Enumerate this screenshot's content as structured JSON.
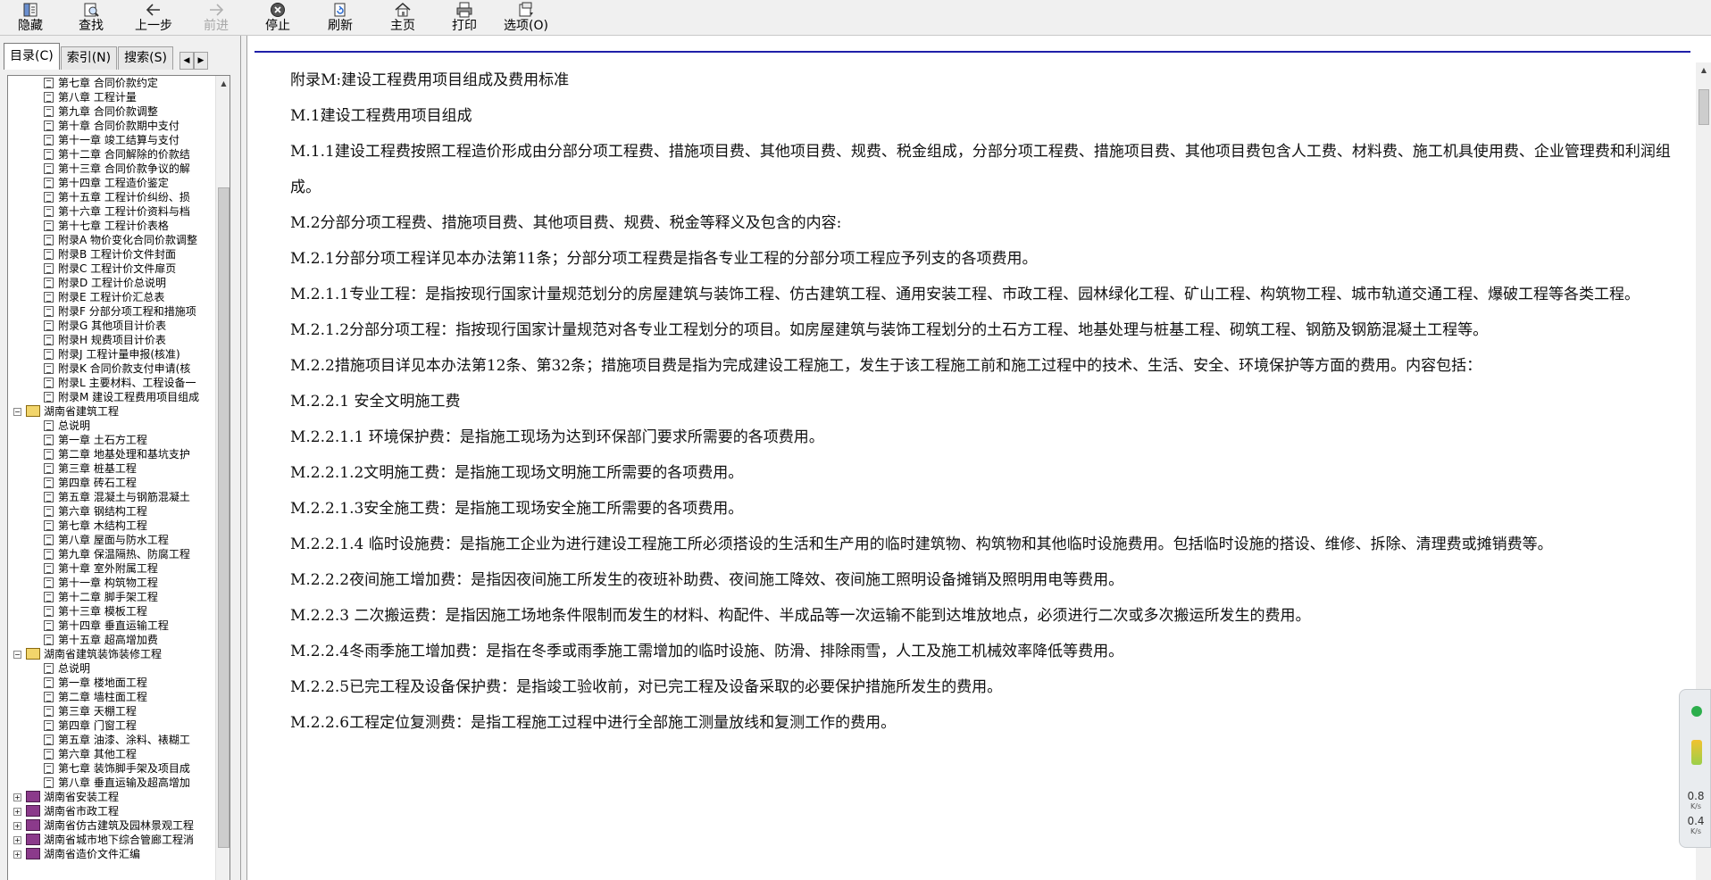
{
  "toolbar": {
    "hide": "隐藏",
    "find": "查找",
    "back": "上一步",
    "forward": "前进",
    "stop": "停止",
    "refresh": "刷新",
    "home": "主页",
    "print": "打印",
    "options": "选项(O)"
  },
  "tabs": {
    "contents": "目录(C)",
    "index": "索引(N)",
    "search": "搜索(S)"
  },
  "tree": {
    "items": [
      {
        "level": 2,
        "kind": "doc",
        "label": "第七章 合同价款约定"
      },
      {
        "level": 2,
        "kind": "doc",
        "label": "第八章 工程计量"
      },
      {
        "level": 2,
        "kind": "doc",
        "label": "第九章 合同价款调整"
      },
      {
        "level": 2,
        "kind": "doc",
        "label": "第十章 合同价款期中支付"
      },
      {
        "level": 2,
        "kind": "doc",
        "label": "第十一章 竣工结算与支付"
      },
      {
        "level": 2,
        "kind": "doc",
        "label": "第十二章 合同解除的价款结"
      },
      {
        "level": 2,
        "kind": "doc",
        "label": "第十三章 合同价款争议的解"
      },
      {
        "level": 2,
        "kind": "doc",
        "label": "第十四章 工程造价鉴定"
      },
      {
        "level": 2,
        "kind": "doc",
        "label": "第十五章 工程计价纠纷、损"
      },
      {
        "level": 2,
        "kind": "doc",
        "label": "第十六章 工程计价资料与档"
      },
      {
        "level": 2,
        "kind": "doc",
        "label": "第十七章 工程计价表格"
      },
      {
        "level": 2,
        "kind": "doc",
        "label": "附录A 物价变化合同价款调整"
      },
      {
        "level": 2,
        "kind": "doc",
        "label": "附录B 工程计价文件封面"
      },
      {
        "level": 2,
        "kind": "doc",
        "label": "附录C 工程计价文件扉页"
      },
      {
        "level": 2,
        "kind": "doc",
        "label": "附录D 工程计价总说明"
      },
      {
        "level": 2,
        "kind": "doc",
        "label": "附录E 工程计价汇总表"
      },
      {
        "level": 2,
        "kind": "doc",
        "label": "附录F 分部分项工程和措施项"
      },
      {
        "level": 2,
        "kind": "doc",
        "label": "附录G 其他项目计价表"
      },
      {
        "level": 2,
        "kind": "doc",
        "label": "附录H 规费项目计价表"
      },
      {
        "level": 2,
        "kind": "doc",
        "label": "附录J 工程计量申报(核准)"
      },
      {
        "level": 2,
        "kind": "doc",
        "label": "附录K 合同价款支付申请(核"
      },
      {
        "level": 2,
        "kind": "doc",
        "label": "附录L 主要材料、工程设备一"
      },
      {
        "level": 2,
        "kind": "doc",
        "label": "附录M 建设工程费用项目组成"
      },
      {
        "level": 1,
        "kind": "book-open",
        "toggle": "−",
        "label": "湖南省建筑工程"
      },
      {
        "level": 2,
        "kind": "doc",
        "label": "总说明"
      },
      {
        "level": 2,
        "kind": "doc",
        "label": "第一章 土石方工程"
      },
      {
        "level": 2,
        "kind": "doc",
        "label": "第二章 地基处理和基坑支护"
      },
      {
        "level": 2,
        "kind": "doc",
        "label": "第三章 桩基工程"
      },
      {
        "level": 2,
        "kind": "doc",
        "label": "第四章 砖石工程"
      },
      {
        "level": 2,
        "kind": "doc",
        "label": "第五章 混凝土与钢筋混凝土"
      },
      {
        "level": 2,
        "kind": "doc",
        "label": "第六章 钢结构工程"
      },
      {
        "level": 2,
        "kind": "doc",
        "label": "第七章 木结构工程"
      },
      {
        "level": 2,
        "kind": "doc",
        "label": "第八章 屋面与防水工程"
      },
      {
        "level": 2,
        "kind": "doc",
        "label": "第九章 保温隔热、防腐工程"
      },
      {
        "level": 2,
        "kind": "doc",
        "label": "第十章 室外附属工程"
      },
      {
        "level": 2,
        "kind": "doc",
        "label": "第十一章 构筑物工程"
      },
      {
        "level": 2,
        "kind": "doc",
        "label": "第十二章 脚手架工程"
      },
      {
        "level": 2,
        "kind": "doc",
        "label": "第十三章 模板工程"
      },
      {
        "level": 2,
        "kind": "doc",
        "label": "第十四章 垂直运输工程"
      },
      {
        "level": 2,
        "kind": "doc",
        "label": "第十五章 超高增加费"
      },
      {
        "level": 1,
        "kind": "book-open",
        "toggle": "−",
        "label": "湖南省建筑装饰装修工程"
      },
      {
        "level": 2,
        "kind": "doc",
        "label": "总说明"
      },
      {
        "level": 2,
        "kind": "doc",
        "label": "第一章 楼地面工程"
      },
      {
        "level": 2,
        "kind": "doc",
        "label": "第二章 墙柱面工程"
      },
      {
        "level": 2,
        "kind": "doc",
        "label": "第三章 天棚工程"
      },
      {
        "level": 2,
        "kind": "doc",
        "label": "第四章 门窗工程"
      },
      {
        "level": 2,
        "kind": "doc",
        "label": "第五章 油漆、涂料、裱糊工"
      },
      {
        "level": 2,
        "kind": "doc",
        "label": "第六章 其他工程"
      },
      {
        "level": 2,
        "kind": "doc",
        "label": "第七章 装饰脚手架及项目成"
      },
      {
        "level": 2,
        "kind": "doc",
        "label": "第八章 垂直运输及超高增加"
      },
      {
        "level": 1,
        "kind": "book",
        "toggle": "+",
        "label": "湖南省安装工程"
      },
      {
        "level": 1,
        "kind": "book",
        "toggle": "+",
        "label": "湖南省市政工程"
      },
      {
        "level": 1,
        "kind": "book",
        "toggle": "+",
        "label": "湖南省仿古建筑及园林景观工程"
      },
      {
        "level": 1,
        "kind": "book",
        "toggle": "+",
        "label": "湖南省城市地下综合管廊工程消"
      },
      {
        "level": 1,
        "kind": "book",
        "toggle": "+",
        "label": "湖南省造价文件汇编"
      }
    ]
  },
  "document": {
    "paragraphs": [
      "附录M:建设工程费用项目组成及费用标准",
      "M.1建设工程费用项目组成",
      "M.1.1建设工程费按照工程造价形成由分部分项工程费、措施项目费、其他项目费、规费、税金组成，分部分项工程费、措施项目费、其他项目费包含人工费、材料费、施工机具使用费、企业管理费和利润组成。",
      "M.2分部分项工程费、措施项目费、其他项目费、规费、税金等释义及包含的内容:",
      "M.2.1分部分项工程详见本办法第11条；分部分项工程费是指各专业工程的分部分项工程应予列支的各项费用。",
      "M.2.1.1专业工程：是指按现行国家计量规范划分的房屋建筑与装饰工程、仿古建筑工程、通用安装工程、市政工程、园林绿化工程、矿山工程、构筑物工程、城市轨道交通工程、爆破工程等各类工程。",
      "M.2.1.2分部分项工程：指按现行国家计量规范对各专业工程划分的项目。如房屋建筑与装饰工程划分的土石方工程、地基处理与桩基工程、砌筑工程、钢筋及钢筋混凝土工程等。",
      "M.2.2措施项目详见本办法第12条、第32条；措施项目费是指为完成建设工程施工，发生于该工程施工前和施工过程中的技术、生活、安全、环境保护等方面的费用。内容包括：",
      "M.2.2.1 安全文明施工费",
      "M.2.2.1.1 环境保护费：是指施工现场为达到环保部门要求所需要的各项费用。",
      "M.2.2.1.2文明施工费：是指施工现场文明施工所需要的各项费用。",
      "M.2.2.1.3安全施工费：是指施工现场安全施工所需要的各项费用。",
      "M.2.2.1.4 临时设施费：是指施工企业为进行建设工程施工所必须搭设的生活和生产用的临时建筑物、构筑物和其他临时设施费用。包括临时设施的搭设、维修、拆除、清理费或摊销费等。",
      "M.2.2.2夜间施工增加费：是指因夜间施工所发生的夜班补助费、夜间施工降效、夜间施工照明设备摊销及照明用电等费用。",
      "M.2.2.3 二次搬运费：是指因施工场地条件限制而发生的材料、构配件、半成品等一次运输不能到达堆放地点，必须进行二次或多次搬运所发生的费用。",
      "M.2.2.4冬雨季施工增加费：是指在冬季或雨季施工需增加的临时设施、防滑、排除雨雪，人工及施工机械效率降低等费用。",
      "M.2.2.5已完工程及设备保护费：是指竣工验收前，对已完工程及设备采取的必要保护措施所发生的费用。",
      "M.2.2.6工程定位复测费：是指工程施工过程中进行全部施工测量放线和复测工作的费用。"
    ]
  },
  "widget": {
    "upload_value": "0.8",
    "upload_unit": "K/s",
    "download_value": "0.4",
    "download_unit": "K/s"
  }
}
